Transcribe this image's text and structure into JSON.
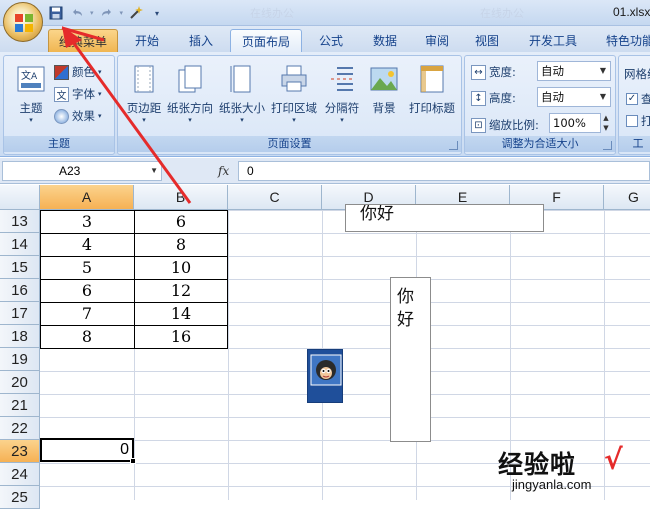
{
  "window": {
    "title": "01.xlsx",
    "faded_tabs": [
      "在线办公",
      "在线办公"
    ]
  },
  "qat": {
    "save_icon": "save-icon",
    "undo_icon": "undo-icon",
    "redo_icon": "redo-icon",
    "custom_icon": "magic-wand-icon",
    "more": "▾"
  },
  "tabs": [
    {
      "label": "经典菜单",
      "type": "classic"
    },
    {
      "label": "开始"
    },
    {
      "label": "插入"
    },
    {
      "label": "页面布局",
      "active": true
    },
    {
      "label": "公式"
    },
    {
      "label": "数据"
    },
    {
      "label": "审阅"
    },
    {
      "label": "视图"
    },
    {
      "label": "开发工具"
    },
    {
      "label": "特色功能"
    }
  ],
  "ribbon": {
    "theme_group": {
      "label": "主题",
      "big_button": "主题",
      "colors": "颜色",
      "fonts": "字体",
      "effects": "效果"
    },
    "page_setup_group": {
      "label": "页面设置",
      "buttons": [
        "页边距",
        "纸张方向",
        "纸张大小",
        "打印区域",
        "分隔符",
        "背景",
        "打印标题"
      ]
    },
    "scale_group": {
      "label": "调整为合适大小",
      "width_label": "宽度:",
      "width_value": "自动",
      "height_label": "高度:",
      "height_value": "自动",
      "scale_label": "缩放比例:",
      "scale_value": "100%"
    },
    "sheet_options_group": {
      "label": "网格线",
      "check1": "查",
      "check2": "打",
      "tail_label": "工"
    }
  },
  "formula_bar": {
    "name_box": "A23",
    "fx": "fx",
    "value": "0"
  },
  "columns": [
    "A",
    "B",
    "C",
    "D",
    "E",
    "F",
    "G"
  ],
  "rows": [
    "13",
    "14",
    "15",
    "16",
    "17",
    "18",
    "19",
    "20",
    "21",
    "22",
    "23",
    "24",
    "25"
  ],
  "table": [
    [
      "3",
      "6"
    ],
    [
      "4",
      "8"
    ],
    [
      "5",
      "10"
    ],
    [
      "6",
      "12"
    ],
    [
      "7",
      "14"
    ],
    [
      "8",
      "16"
    ]
  ],
  "active_cell_value": "0",
  "textbox1": "你好",
  "textbox2_lines": [
    "你",
    "好"
  ],
  "watermark": {
    "text": "经验啦",
    "check": "√",
    "url": "jingyanla.com"
  },
  "colors": {
    "accent_red": "#e52b2b",
    "selected_header": "#f6b154"
  }
}
